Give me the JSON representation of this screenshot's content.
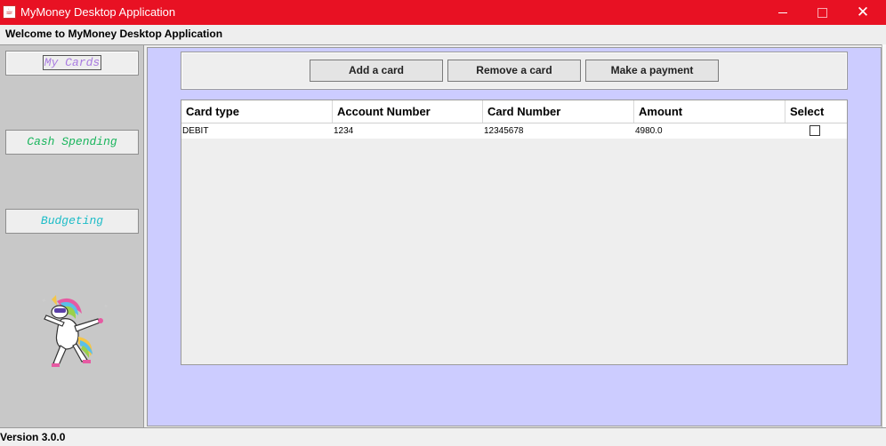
{
  "window": {
    "title": "MyMoney Desktop Application",
    "app_icon": "java-cup-icon",
    "controls": [
      "minimize-icon",
      "maximize-icon",
      "close-icon"
    ],
    "titlebar_color": "#e81123"
  },
  "header": {
    "welcome": "Welcome to MyMoney Desktop Application"
  },
  "sidebar": {
    "items": [
      {
        "label": "My Cards",
        "color": "#a97be0",
        "selected": true
      },
      {
        "label": "Cash Spending",
        "color": "#19b55c"
      },
      {
        "label": "Budgeting",
        "color": "#1cbcc7"
      }
    ],
    "mascot": "dabbing-unicorn-image"
  },
  "toolbar": {
    "add_label": "Add a card",
    "remove_label": "Remove a card",
    "pay_label": "Make a payment"
  },
  "table": {
    "columns": [
      "Card type",
      "Account Number",
      "Card Number",
      "Amount",
      "Select"
    ],
    "rows": [
      {
        "card_type": "DEBIT",
        "account_number": "1234",
        "card_number": "12345678",
        "amount": "4980.0",
        "selected": false
      }
    ]
  },
  "main": {
    "background": "#ccccff"
  },
  "status": {
    "version": "Version 3.0.0"
  }
}
